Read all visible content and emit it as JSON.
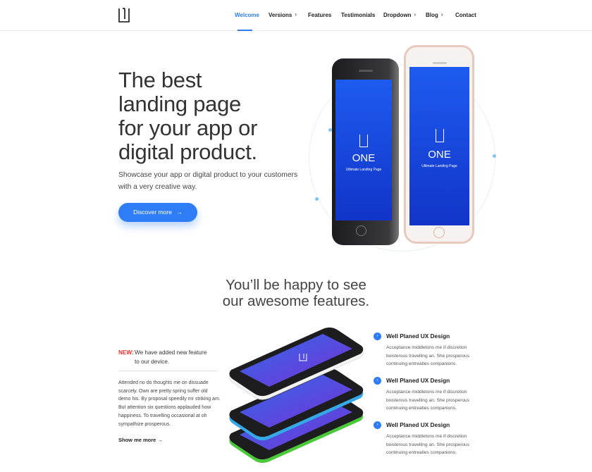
{
  "nav": {
    "items": [
      {
        "label": "Welcome",
        "active": true,
        "has_chevron": false
      },
      {
        "label": "Versions",
        "active": false,
        "has_chevron": true
      },
      {
        "label": "Features",
        "active": false,
        "has_chevron": false
      },
      {
        "label": "Testimonials",
        "active": false,
        "has_chevron": false
      },
      {
        "label": "Dropdown",
        "active": false,
        "has_chevron": true
      },
      {
        "label": "Blog",
        "active": false,
        "has_chevron": true
      },
      {
        "label": "Contact",
        "active": false,
        "has_chevron": false
      }
    ],
    "chevron": "›"
  },
  "hero": {
    "title_lines": [
      "The best",
      "landing page",
      "for your app or",
      "digital product."
    ],
    "subtitle": "Showcase your app or digital product to your customers with a very creative way.",
    "cta_label": "Discover more",
    "cta_arrow": "→"
  },
  "phone_screen": {
    "brand_name": "ONE",
    "brand_tagline": "Ultimate Landing Page"
  },
  "features_section": {
    "title_line1": "You’ll be happy to see",
    "title_line2": "our awesome features.",
    "new_label": "NEW:",
    "new_text": "We have added new feature to our device.",
    "body": "Attended no do thoughts me on dissuade scarcely. Own are pretty spring suffer old demo his. By proposal speedily mr striking am. But attention six questions applauded how happiness. To travelling occasional at oh sympathize prosperous.",
    "more_link": "Show me more →",
    "items": [
      {
        "title": "Well Planed UX Design",
        "desc": "Acceptance middletons me if discretion boisterous travelling an. She prosperous continuing entreaties companions."
      },
      {
        "title": "Well Planed UX Design",
        "desc": "Acceptance middletons me if discretion boisterous travelling an. She prosperous continuing entreaties companions."
      },
      {
        "title": "Well Planed UX Design",
        "desc": "Acceptance middletons me if discretion boisterous travelling an. She prosperous continuing entreaties companions."
      }
    ]
  },
  "colors": {
    "accent": "#2f7df6",
    "new_label": "#e4322b",
    "screen_top": "#1e5bf0",
    "screen_bottom": "#1234c8"
  }
}
